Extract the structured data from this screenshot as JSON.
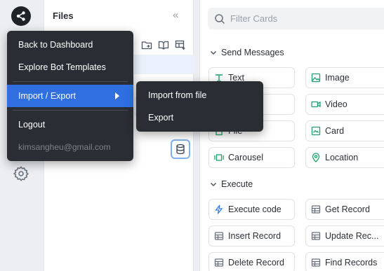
{
  "files_panel": {
    "title": "Files",
    "collapse_icon": "double-chevron-left-icon",
    "toolbar_icons": [
      "new-folder-icon",
      "book-icon",
      "table-add-icon"
    ]
  },
  "filter": {
    "placeholder": "Filter Cards"
  },
  "sections": [
    {
      "title": "Send Messages",
      "cards": [
        {
          "label": "Text",
          "icon": "text-icon",
          "color": "#22a06b"
        },
        {
          "label": "Image",
          "icon": "image-icon",
          "color": "#22a06b"
        },
        {
          "label": "",
          "icon": "",
          "color": "#22a06b"
        },
        {
          "label": "Video",
          "icon": "video-icon",
          "color": "#22a06b"
        },
        {
          "label": "File",
          "icon": "file-icon",
          "color": "#22a06b"
        },
        {
          "label": "Card",
          "icon": "card-icon",
          "color": "#22a06b"
        },
        {
          "label": "Carousel",
          "icon": "carousel-icon",
          "color": "#22a06b"
        },
        {
          "label": "Location",
          "icon": "location-pin-icon",
          "color": "#22a06b"
        }
      ]
    },
    {
      "title": "Execute",
      "cards": [
        {
          "label": "Execute code",
          "icon": "lightning-icon",
          "color": "#3b7be0"
        },
        {
          "label": "Get Record",
          "icon": "table-icon",
          "color": "#6b7280"
        },
        {
          "label": "Insert Record",
          "icon": "table-icon",
          "color": "#6b7280"
        },
        {
          "label": "Update Rec...",
          "icon": "table-icon",
          "color": "#6b7280"
        },
        {
          "label": "Delete Record",
          "icon": "table-icon",
          "color": "#6b7280"
        },
        {
          "label": "Find Records",
          "icon": "table-icon",
          "color": "#6b7280"
        }
      ]
    }
  ],
  "menu": {
    "items": [
      {
        "label": "Back to Dashboard"
      },
      {
        "label": "Explore Bot Templates"
      },
      {
        "label": "Import / Export",
        "active": true
      },
      {
        "label": "Logout"
      }
    ],
    "account_email": "kimsangheu@gmail.com"
  },
  "submenu": {
    "items": [
      {
        "label": "Import from file"
      },
      {
        "label": "Export"
      }
    ]
  },
  "colors": {
    "accent": "#2f6fe0",
    "menu_bg": "#2a2d33",
    "send_icon": "#22a06b",
    "execute_icon": "#3b7be0"
  }
}
